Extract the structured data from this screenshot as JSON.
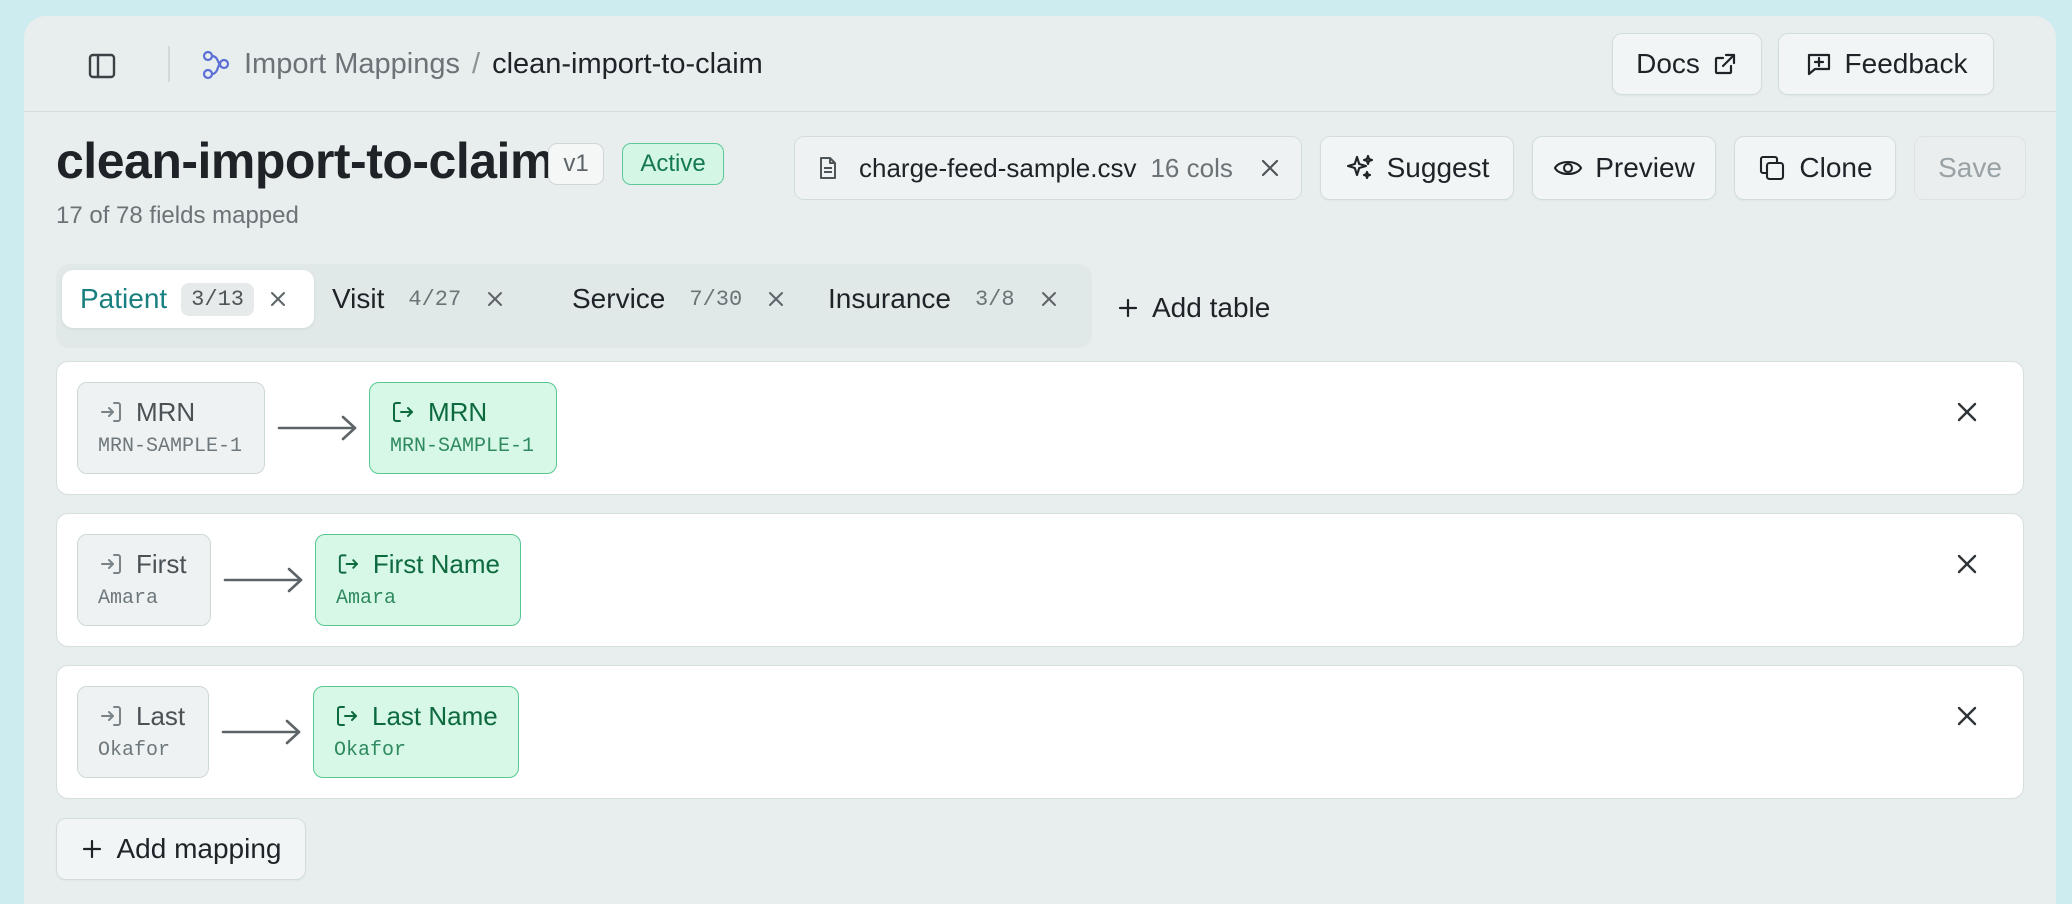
{
  "breadcrumb": {
    "parent": "Import Mappings",
    "separator": "/",
    "current": "clean-import-to-claim"
  },
  "topbar": {
    "docs_label": "Docs",
    "feedback_label": "Feedback"
  },
  "header": {
    "title": "clean-import-to-claim",
    "version": "v1",
    "status": "Active",
    "status_color": "#137a4e",
    "subtitle": "17 of 78 fields mapped"
  },
  "file": {
    "name": "charge-feed-sample.csv",
    "cols": "16 cols"
  },
  "actions": {
    "suggest_label": "Suggest",
    "preview_label": "Preview",
    "clone_label": "Clone",
    "save_label": "Save"
  },
  "tabs": [
    {
      "label": "Patient",
      "count": "3/13",
      "active": true
    },
    {
      "label": "Visit",
      "count": "4/27",
      "active": false
    },
    {
      "label": "Service",
      "count": "7/30",
      "active": false
    },
    {
      "label": "Insurance",
      "count": "3/8",
      "active": false
    }
  ],
  "add_table_label": "Add table",
  "mappings": [
    {
      "source_field": "MRN",
      "source_sample": "MRN-SAMPLE-1",
      "target_field": "MRN",
      "target_sample": "MRN-SAMPLE-1"
    },
    {
      "source_field": "First",
      "source_sample": "Amara",
      "target_field": "First Name",
      "target_sample": "Amara"
    },
    {
      "source_field": "Last",
      "source_sample": "Okafor",
      "target_field": "Last Name",
      "target_sample": "Okafor"
    }
  ],
  "add_mapping_label": "Add mapping",
  "colors": {
    "accent": "#1a7f7f",
    "target_bg": "#d7f8e6",
    "target_border": "#58c892"
  }
}
